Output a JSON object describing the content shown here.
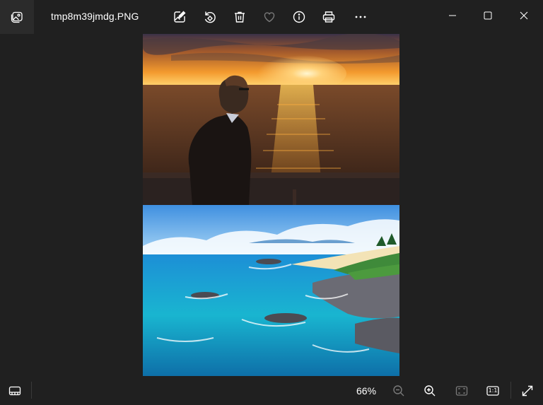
{
  "window": {
    "filename": "tmp8m39jmdg.PNG"
  },
  "toolbar": {
    "icons": [
      "gallery-icon",
      "edit-image-icon",
      "rotate-icon",
      "delete-icon",
      "favorite-icon",
      "info-icon",
      "print-icon",
      "more-icon"
    ]
  },
  "window_controls": {
    "icons": [
      "minimize-icon",
      "maximize-icon",
      "close-icon"
    ]
  },
  "image": {
    "panels": [
      "sunset-man-scene",
      "coastal-cliff-scene"
    ]
  },
  "status": {
    "zoom_level": "66%"
  },
  "bottom_controls": {
    "icons": [
      "filmstrip-icon",
      "zoom-out-icon",
      "zoom-in-icon",
      "fit-to-window-icon",
      "actual-size-icon",
      "full-screen-icon"
    ],
    "actual_size_label": "1:1"
  },
  "colors": {
    "background": "#202020",
    "icon": "#ffffff",
    "icon_disabled": "#7a7a7a"
  }
}
